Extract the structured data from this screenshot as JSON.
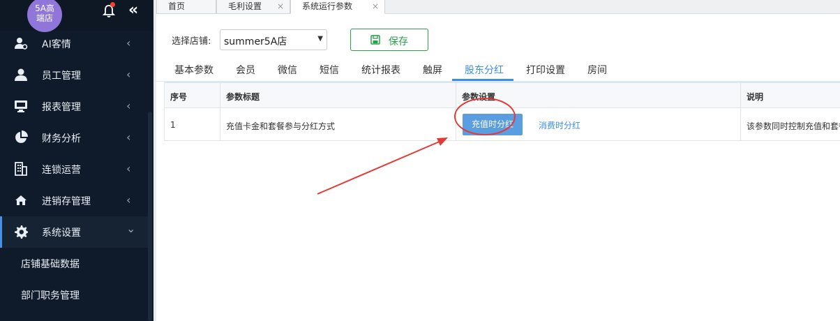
{
  "sidebar": {
    "store_avatar_line1": "5A高",
    "store_avatar_line2": "端店",
    "collapse_glyph": "«",
    "items": [
      {
        "label": "AI客情",
        "icon": "user-tag-icon",
        "arrow": "‹"
      },
      {
        "label": "员工管理",
        "icon": "user-icon",
        "arrow": "‹"
      },
      {
        "label": "报表管理",
        "icon": "monitor-icon",
        "arrow": "‹"
      },
      {
        "label": "财务分析",
        "icon": "pie-chart-icon",
        "arrow": "‹"
      },
      {
        "label": "连锁运营",
        "icon": "building-icon",
        "arrow": "‹"
      },
      {
        "label": "进销存管理",
        "icon": "home-icon",
        "arrow": "‹"
      },
      {
        "label": "系统设置",
        "icon": "gear-icon",
        "arrow": "⌄"
      }
    ],
    "sub_items": [
      {
        "label": "店铺基础数据"
      },
      {
        "label": "部门职务管理"
      }
    ]
  },
  "tabs": [
    {
      "label": "首页",
      "close": ""
    },
    {
      "label": "毛利设置",
      "close": "×"
    },
    {
      "label": "系统运行参数",
      "close": "×"
    }
  ],
  "toolbar": {
    "store_label": "选择店铺:",
    "store_value": "summer5A店",
    "save_label": "保存"
  },
  "subtabs": [
    "基本参数",
    "会员",
    "微信",
    "短信",
    "统计报表",
    "触屏",
    "股东分红",
    "打印设置",
    "房间"
  ],
  "active_subtab": "股东分红",
  "table": {
    "headers": [
      "序号",
      "参数标题",
      "参数设置",
      "说明"
    ],
    "rows": [
      {
        "index": "1",
        "title": "充值卡金和套餐参与分红方式",
        "option_active": "充值时分红",
        "option_other": "消费时分红",
        "description": "该参数同时控制充值和套餐"
      }
    ]
  },
  "colors": {
    "sidebar_bg": "#0f1b2a",
    "accent": "#3a8ee6",
    "save_green": "#2aa14a",
    "annotation_red": "#e53935"
  }
}
